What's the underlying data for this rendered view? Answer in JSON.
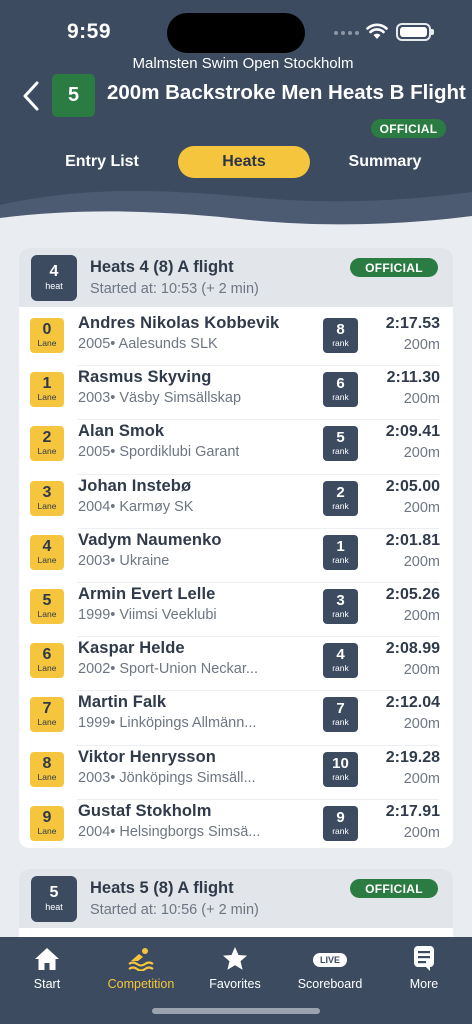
{
  "status": {
    "time": "9:59"
  },
  "header": {
    "meet_name": "Malmsten Swim Open Stockholm",
    "event_number": "5",
    "event_title": "200m Backstroke Men Heats B Flight",
    "status_label": "OFFICIAL"
  },
  "tabs": [
    {
      "label": "Entry List"
    },
    {
      "label": "Heats"
    },
    {
      "label": "Summary"
    }
  ],
  "active_tab": "Heats",
  "heats": [
    {
      "number": "4",
      "badge_label": "heat",
      "title": "Heats 4 (8) A flight",
      "started": "Started at:  10:53 (+ 2 min)",
      "status_label": "OFFICIAL",
      "entries": [
        {
          "lane": "0",
          "lane_label": "Lane",
          "name": "Andres Nikolas Kobbevik",
          "club": "2005• Aalesunds SLK",
          "rank": "8",
          "rank_label": "rank",
          "time": "2:17.53",
          "distance": "200m"
        },
        {
          "lane": "1",
          "lane_label": "Lane",
          "name": "Rasmus Skyving",
          "club": "2003• Väsby Simsällskap",
          "rank": "6",
          "rank_label": "rank",
          "time": "2:11.30",
          "distance": "200m"
        },
        {
          "lane": "2",
          "lane_label": "Lane",
          "name": "Alan Smok",
          "club": "2005• Spordiklubi Garant",
          "rank": "5",
          "rank_label": "rank",
          "time": "2:09.41",
          "distance": "200m"
        },
        {
          "lane": "3",
          "lane_label": "Lane",
          "name": "Johan Instebø",
          "club": "2004• Karmøy SK",
          "rank": "2",
          "rank_label": "rank",
          "time": "2:05.00",
          "distance": "200m"
        },
        {
          "lane": "4",
          "lane_label": "Lane",
          "name": "Vadym Naumenko",
          "club": "2003• Ukraine",
          "rank": "1",
          "rank_label": "rank",
          "time": "2:01.81",
          "distance": "200m"
        },
        {
          "lane": "5",
          "lane_label": "Lane",
          "name": "Armin Evert Lelle",
          "club": "1999• Viimsi Veeklubi",
          "rank": "3",
          "rank_label": "rank",
          "time": "2:05.26",
          "distance": "200m"
        },
        {
          "lane": "6",
          "lane_label": "Lane",
          "name": "Kaspar Helde",
          "club": "2002• Sport-Union Neckar...",
          "rank": "4",
          "rank_label": "rank",
          "time": "2:08.99",
          "distance": "200m"
        },
        {
          "lane": "7",
          "lane_label": "Lane",
          "name": "Martin Falk",
          "club": "1999• Linköpings Allmänn...",
          "rank": "7",
          "rank_label": "rank",
          "time": "2:12.04",
          "distance": "200m"
        },
        {
          "lane": "8",
          "lane_label": "Lane",
          "name": "Viktor Henrysson",
          "club": "2003• Jönköpings Simsäll...",
          "rank": "10",
          "rank_label": "rank",
          "time": "2:19.28",
          "distance": "200m"
        },
        {
          "lane": "9",
          "lane_label": "Lane",
          "name": "Gustaf Stokholm",
          "club": "2004• Helsingborgs Simsä...",
          "rank": "9",
          "rank_label": "rank",
          "time": "2:17.91",
          "distance": "200m"
        }
      ]
    },
    {
      "number": "5",
      "badge_label": "heat",
      "title": "Heats 5 (8) A flight",
      "started": "Started at:  10:56 (+ 2 min)",
      "status_label": "OFFICIAL"
    }
  ],
  "tabbar": [
    {
      "label": "Start",
      "icon": "home-icon"
    },
    {
      "label": "Competition",
      "icon": "swimmer-icon"
    },
    {
      "label": "Favorites",
      "icon": "star-icon"
    },
    {
      "label": "Scoreboard",
      "icon": "live-icon",
      "badge": "LIVE"
    },
    {
      "label": "More",
      "icon": "document-icon"
    }
  ],
  "active_tabbar": "Competition",
  "colors": {
    "header_bg": "#3c4b60",
    "accent": "#f5c63d",
    "official": "#2b7c43"
  }
}
